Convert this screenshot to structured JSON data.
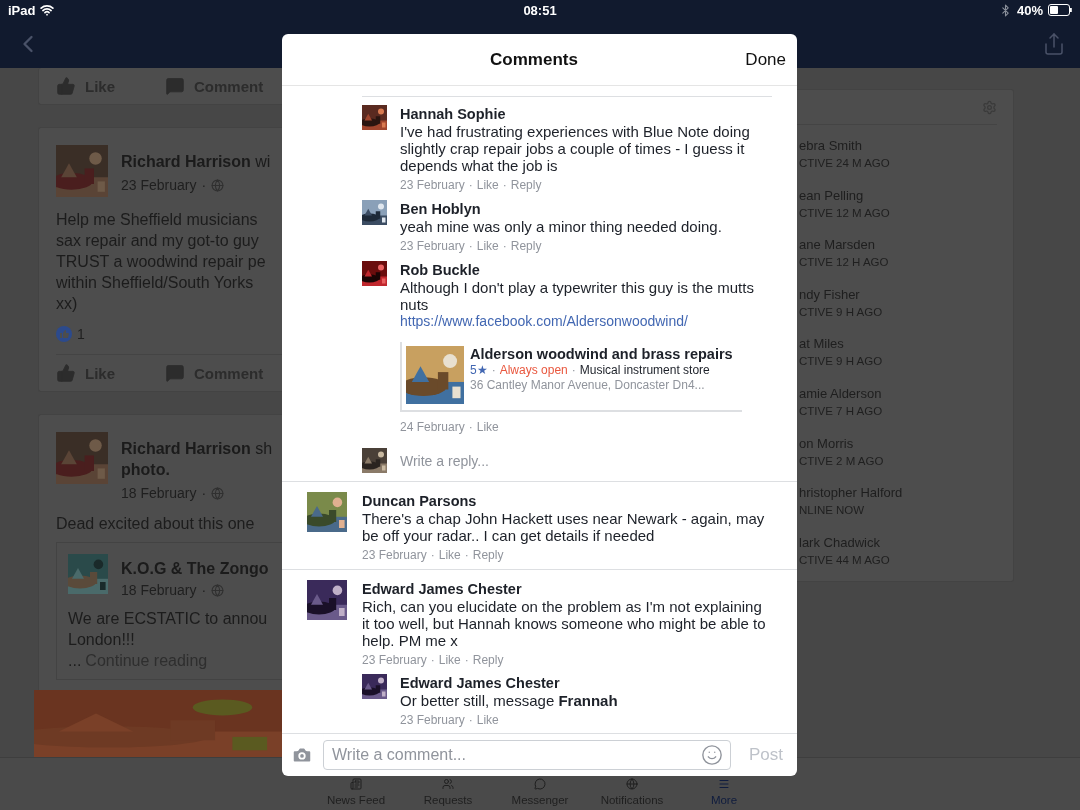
{
  "status_bar": {
    "device": "iPad",
    "time": "08:51",
    "battery": "40%"
  },
  "feed": {
    "separator": "·",
    "posts": [
      {
        "kind": "actions_only",
        "actions": [
          "Like",
          "Comment"
        ]
      },
      {
        "kind": "post",
        "header": "**Richard Harrison** wi",
        "date": "23 February",
        "lines": [
          "Help me Sheffield musicians",
          "sax repair and my got-to guy",
          "TRUST a woodwind repair pe",
          "within Sheffield/South Yorks",
          "xx)"
        ],
        "likes": "1",
        "actions": [
          "Like",
          "Comment"
        ]
      },
      {
        "kind": "shared",
        "header": "**Richard Harrison** sh **photo.**",
        "date": "18 February",
        "lines": [
          "Dead excited about this one"
        ],
        "shared": {
          "author": "K.O.G & The Zongo",
          "date": "18 February",
          "lines": [
            "We are ECSTATIC to annou",
            "London!!!"
          ],
          "ellipsis": "...",
          "more": "Continue reading"
        }
      }
    ]
  },
  "sidebar": {
    "contacts": [
      {
        "name": "ebra Smith",
        "status": "CTIVE 24 M AGO"
      },
      {
        "name": "ean Pelling",
        "status": "CTIVE 12 M AGO"
      },
      {
        "name": "ane Marsden",
        "status": "CTIVE 12 H AGO"
      },
      {
        "name": "ndy Fisher",
        "status": "CTIVE 9 H AGO"
      },
      {
        "name": "at Miles",
        "status": "CTIVE 9 H AGO"
      },
      {
        "name": "amie Alderson",
        "status": "CTIVE 7 H AGO"
      },
      {
        "name": "on Morris",
        "status": "CTIVE 2 M AGO"
      },
      {
        "name": "hristopher Halford",
        "status": "NLINE NOW"
      },
      {
        "name": "lark Chadwick",
        "status": "CTIVE 44 M AGO"
      }
    ]
  },
  "tab_bar": {
    "tabs": [
      {
        "label": "News Feed",
        "selected": false
      },
      {
        "label": "Requests",
        "selected": false
      },
      {
        "label": "Messenger",
        "selected": false
      },
      {
        "label": "Notifications",
        "selected": false
      },
      {
        "label": "More",
        "selected": true
      }
    ]
  },
  "modal": {
    "title": "Comments",
    "done": "Done",
    "separator": "·",
    "threads": [
      {
        "replies": [
          {
            "name": "Hannah Sophie",
            "text": "I've had frustrating experiences with Blue Note doing slightly crap repair jobs a couple of times - I guess it depends what the job is",
            "meta": [
              "23 February",
              "Like",
              "Reply"
            ]
          },
          {
            "name": "Ben Hoblyn",
            "text": "yeah mine was only a minor thing needed doing.",
            "meta": [
              "23 February",
              "Like",
              "Reply"
            ]
          },
          {
            "name": "Rob Buckle",
            "text": "Although I don't play a typewriter this guy is the mutts nuts",
            "link": "https://www.facebook.com/Aldersonwoodwind/",
            "preview": {
              "title": "Alderson woodwind and brass repairs",
              "rating": "5★",
              "hours": "Always open",
              "category": "Musical instrument store",
              "address": "36 Cantley Manor Avenue, Doncaster Dn4..."
            },
            "meta": [
              "24 February",
              "Like"
            ]
          }
        ],
        "reply_field": {
          "placeholder": "Write a reply..."
        }
      },
      {
        "comment": {
          "name": "Duncan Parsons",
          "text": "There's a chap John Hackett uses near Newark - again, may be off your radar.. I can get details if needed",
          "meta": [
            "23 February",
            "Like",
            "Reply"
          ]
        }
      },
      {
        "comment": {
          "name": "Edward James Chester",
          "text": "Rich, can you elucidate on the problem as I'm not explaining it too well, but Hannah knows someone who might be able to help. PM me x",
          "meta": [
            "23 February",
            "Like",
            "Reply"
          ]
        },
        "replies": [
          {
            "name": "Edward James Chester",
            "text": "Or better still, message **Frannah**",
            "meta": [
              "23 February",
              "Like"
            ]
          }
        ]
      }
    ],
    "composer": {
      "placeholder": "Write a comment...",
      "post": {
        "label": "Post",
        "disabled": true
      }
    }
  }
}
